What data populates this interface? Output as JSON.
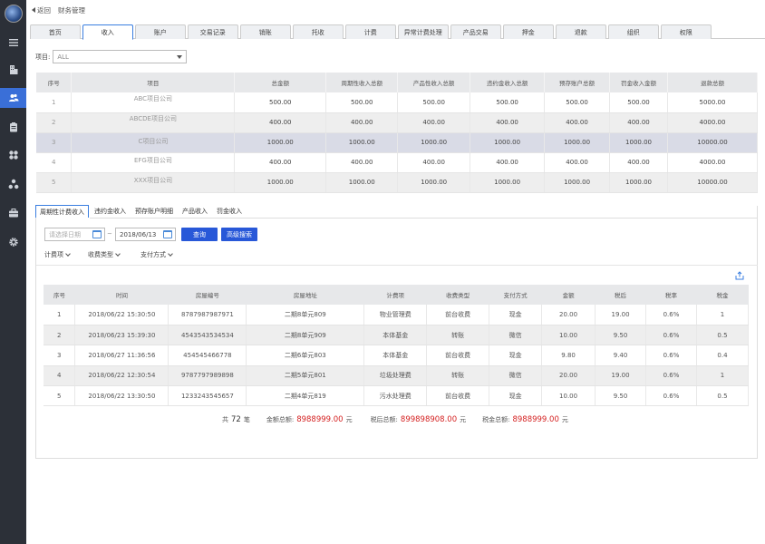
{
  "topbar": {
    "back_label": "返回",
    "title": "财务管理"
  },
  "main_tabs": [
    "首页",
    "收入",
    "账户",
    "交易记录",
    "销账",
    "托收",
    "计费",
    "异常计费处理",
    "产品交易",
    "押金",
    "退款",
    "组织",
    "权限"
  ],
  "filter": {
    "label": "项目:",
    "value": "ALL"
  },
  "summary_table": {
    "headers": [
      "序号",
      "项目",
      "总金额",
      "周期性收入总额",
      "产品性收入总额",
      "违约金收入总额",
      "预存账户总额",
      "罚金收入金额",
      "退款总额"
    ],
    "rows": [
      [
        "1",
        "ABC项目公司",
        "500.00",
        "500.00",
        "500.00",
        "500.00",
        "500.00",
        "500.00",
        "5000.00"
      ],
      [
        "2",
        "ABCDE项目公司",
        "400.00",
        "400.00",
        "400.00",
        "400.00",
        "400.00",
        "400.00",
        "4000.00"
      ],
      [
        "3",
        "C项目公司",
        "1000.00",
        "1000.00",
        "1000.00",
        "1000.00",
        "1000.00",
        "1000.00",
        "10000.00"
      ],
      [
        "4",
        "EFG项目公司",
        "400.00",
        "400.00",
        "400.00",
        "400.00",
        "400.00",
        "400.00",
        "4000.00"
      ],
      [
        "5",
        "XXX项目公司",
        "1000.00",
        "1000.00",
        "1000.00",
        "1000.00",
        "1000.00",
        "1000.00",
        "10000.00"
      ]
    ]
  },
  "sub_tabs": [
    "周期性计费收入",
    "违约金收入",
    "预存账户明细",
    "产品收入",
    "罚金收入"
  ],
  "search": {
    "start_placeholder": "请选择日期",
    "separator": "~",
    "end_value": "2018/06/13",
    "query_label": "查询",
    "advanced_label": "高级搜索",
    "dropdowns": [
      "计费项",
      "收费类型",
      "支付方式"
    ]
  },
  "detail_table": {
    "headers": [
      "序号",
      "时间",
      "房屋编号",
      "房屋地址",
      "计费项",
      "收费类型",
      "支付方式",
      "金额",
      "税后",
      "税率",
      "税金"
    ],
    "rows": [
      [
        "1",
        "2018/06/22 15:30:50",
        "8787987987971",
        "二期8单元809",
        "物业管理费",
        "前台收费",
        "现金",
        "20.00",
        "19.00",
        "0.6%",
        "1"
      ],
      [
        "2",
        "2018/06/23 15:39:30",
        "4543543534534",
        "二期8单元909",
        "本体基金",
        "转账",
        "微信",
        "10.00",
        "9.50",
        "0.6%",
        "0.5"
      ],
      [
        "3",
        "2018/06/27 11:36:56",
        "454545466778",
        "二期6单元803",
        "本体基金",
        "前台收费",
        "现金",
        "9.80",
        "9.40",
        "0.6%",
        "0.4"
      ],
      [
        "4",
        "2018/06/22 12:30:54",
        "9787797989898",
        "二期5单元801",
        "垃圾处理费",
        "转账",
        "微信",
        "20.00",
        "19.00",
        "0.6%",
        "1"
      ],
      [
        "5",
        "2018/06/22 13:30:50",
        "1233243545657",
        "二期4单元819",
        "污水处理费",
        "前台收费",
        "现金",
        "10.00",
        "9.50",
        "0.6%",
        "0.5"
      ]
    ]
  },
  "summary": {
    "total_prefix": "共",
    "total_count": "72",
    "total_suffix": "笔",
    "amount_label": "金额总额:",
    "amount_value": "8988999.00",
    "amount_unit": "元",
    "after_tax_label": "税后总额:",
    "after_tax_value": "899898908.00",
    "after_tax_unit": "元",
    "tax_label": "税金总额:",
    "tax_value": "8988999.00",
    "tax_unit": "元"
  },
  "colors": {
    "sidebar": "#2c3038",
    "accent": "#3a6fd8",
    "button": "#2858d8",
    "money": "#d42020"
  },
  "icons": [
    "menu-icon",
    "building-icon",
    "users-icon",
    "clipboard-icon",
    "grid-icon",
    "org-chart-icon",
    "briefcase-icon",
    "gear-icon",
    "export-icon",
    "calendar-icon"
  ]
}
